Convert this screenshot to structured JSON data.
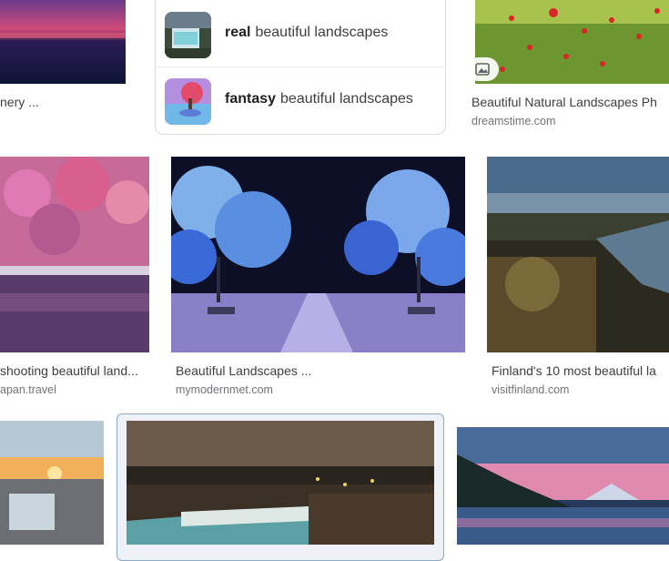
{
  "suggestions": [
    {
      "bold": "real",
      "rest": "beautiful landscapes"
    },
    {
      "bold": "fantasy",
      "rest": "beautiful landscapes"
    }
  ],
  "results": [
    {
      "caption": "nery ...",
      "source": ""
    },
    {
      "caption": "Beautiful Natural Landscapes Ph",
      "source": "dreamstime.com"
    },
    {
      "caption": "shooting beautiful land...",
      "source": "apan.travel"
    },
    {
      "caption": "Beautiful Landscapes ...",
      "source": "mymodernmet.com"
    },
    {
      "caption": "Finland's 10 most beautiful la",
      "source": "visitfinland.com"
    }
  ],
  "icons": {
    "image_badge": "image-icon"
  },
  "colors": {
    "selected_border": "#8fa7c9",
    "caption": "#3c4043",
    "source": "#70757a"
  }
}
